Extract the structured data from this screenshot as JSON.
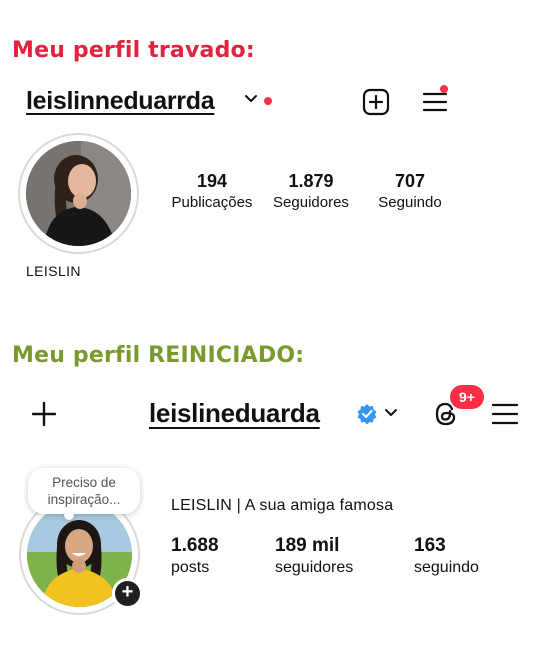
{
  "headings": {
    "top": "Meu perfil travado:",
    "bottom": "Meu perfil REINICIADO:"
  },
  "profile_locked": {
    "username": "leislinneduarrda",
    "display_name": "LEISLIN",
    "stats": [
      {
        "value": "194",
        "label": "Publicações"
      },
      {
        "value": "1.879",
        "label": "Seguidores"
      },
      {
        "value": "707",
        "label": "Seguindo"
      }
    ],
    "icons": [
      "chevron-down-icon",
      "notification-dot",
      "new-post-icon",
      "menu-icon"
    ]
  },
  "profile_restarted": {
    "username": "leislineduarda",
    "bio_name": "LEISLIN | A sua amiga famosa",
    "note": "Preciso de inspiração...",
    "threads_badge": "9+",
    "add_story_glyph": "+",
    "stats": [
      {
        "value": "1.688",
        "label": "posts"
      },
      {
        "value": "189 mil",
        "label": "seguidores"
      },
      {
        "value": "163",
        "label": "seguindo"
      }
    ],
    "icons": [
      "plus-icon",
      "verified-badge-icon",
      "chevron-down-icon",
      "threads-icon",
      "menu-icon"
    ]
  },
  "colors": {
    "heading_top": "#e0243d",
    "heading_bottom": "#7a9a2e",
    "notification_red": "#ff2d46",
    "verified_blue": "#3897f0"
  }
}
